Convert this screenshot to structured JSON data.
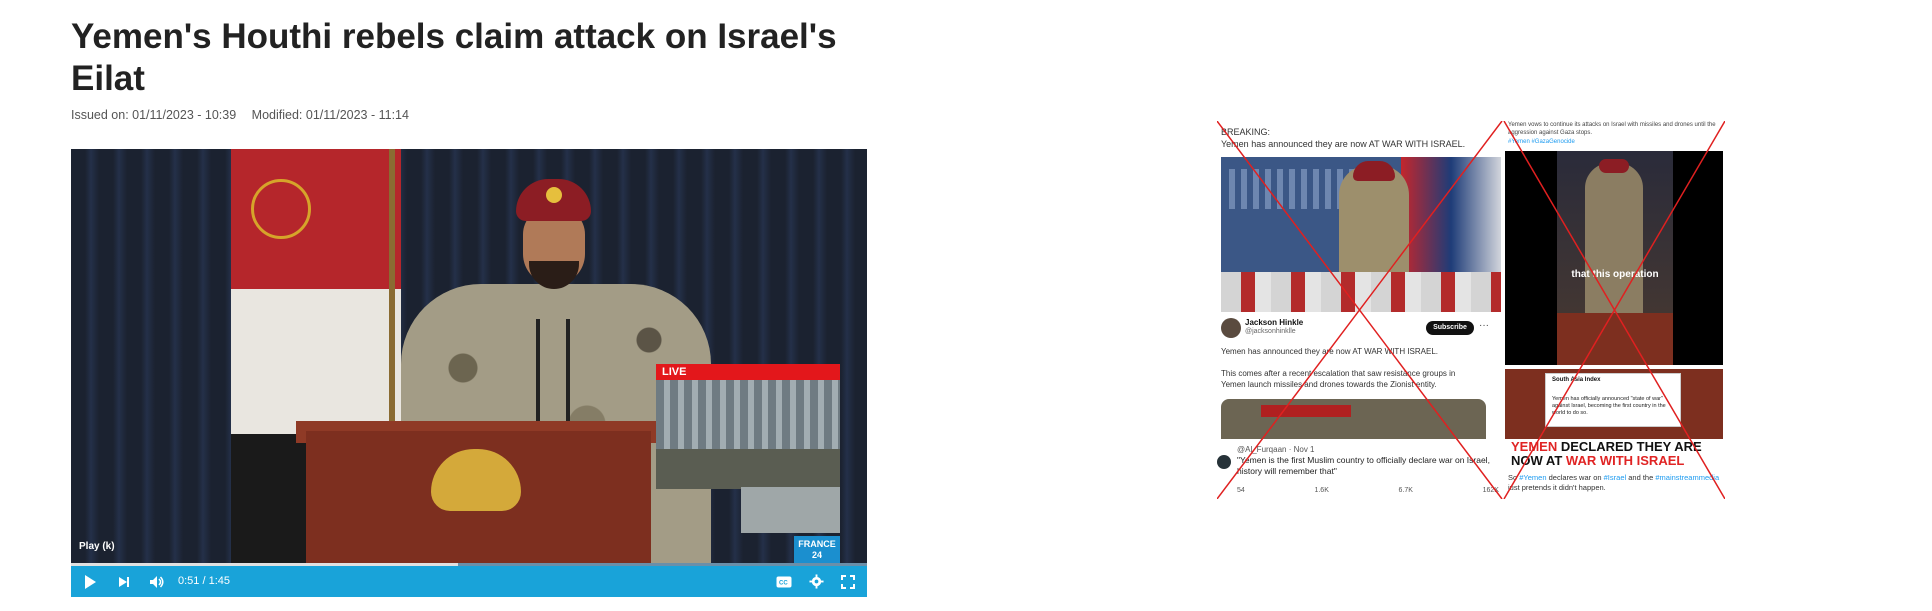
{
  "article": {
    "headline": "Yemen's Houthi rebels claim attack on Israel's Eilat",
    "issued_on": "Issued on: 01/11/2023 - 10:39",
    "modified": "Modified: 01/11/2023 - 11:14"
  },
  "player": {
    "play_hint": "Play (k)",
    "time": "0:51 / 1:45",
    "progress": 0.4857,
    "live_label": "LIVE",
    "channel_logo": "FRANCE 24",
    "controls": {
      "play_icon": "play-icon",
      "next_icon": "next-icon",
      "volume_icon": "volume-icon",
      "captions_icon": "captions-icon",
      "settings_icon": "gear-icon",
      "fullscreen_icon": "fullscreen-icon"
    },
    "accent_color": "#19a3d9"
  },
  "collage": {
    "left_tweet": {
      "breaking": "BREAKING:",
      "headline": "Yemen has announced they are now AT WAR WITH ISRAEL.",
      "author_name": "Jackson Hinkle",
      "author_handle": "@jacksonhinklle",
      "subscribe": "Subscribe",
      "line1": "Yemen has announced they are now AT WAR WITH ISRAEL.",
      "line2": "This comes after a recent escalation that saw resistance groups in",
      "line3": "Yemen launch missiles and drones towards the Zionist entity.",
      "quote_head": "@Al_Furqaan · Nov 1",
      "quote_text": "\"Yemen is the first Muslim country to officially declare war on Israel, history will remember that\"",
      "stats": [
        "54",
        "1.6K",
        "6.7K",
        "162K"
      ]
    },
    "right_tweet": {
      "top_text": "Yemen vows to continue its attacks on Israel with missiles and drones until the aggression against Gaza stops.",
      "top_tags": "#Yemen #GazaGenocide",
      "video_caption": "that this operation",
      "card_head": "South Asia Index",
      "card_text": "Yemen has officially announced \"state of war\" against Israel, becoming the first country in the world to do so.",
      "banner_line1_red": "YEMEN",
      "banner_line1_rest": " DECLARED THEY ARE",
      "banner_line2_rest": "NOW AT ",
      "banner_line2_red": "WAR WITH ISRAEL",
      "footer_prefix": "So ",
      "footer_tag1": "#Yemen",
      "footer_mid": " declares war on ",
      "footer_tag2": "#Israel",
      "footer_mid2": " and the ",
      "footer_tag3": "#mainstreammedia",
      "footer_suffix": " just pretends it didn't happen."
    },
    "cross_color": "#e02020"
  }
}
